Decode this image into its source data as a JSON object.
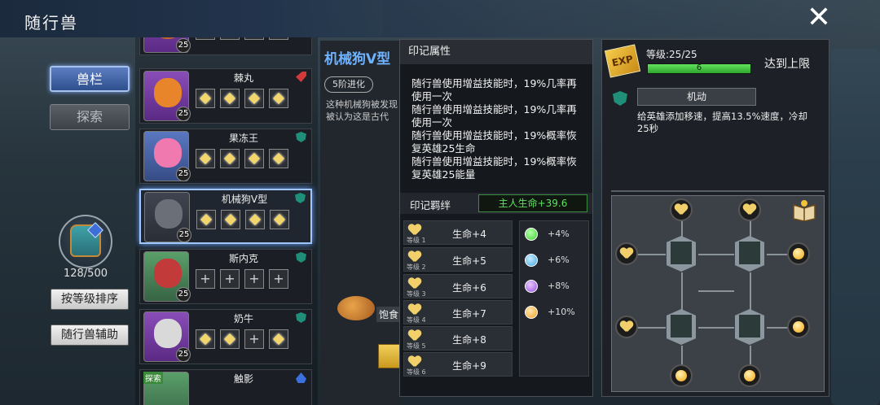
{
  "window": {
    "title": "随行兽",
    "close_label": "✕"
  },
  "left_nav": {
    "tabs": [
      {
        "label": "兽栏",
        "active": true
      },
      {
        "label": "探索",
        "active": false
      }
    ],
    "capacity": "128/500",
    "sort_button": "按等级排序",
    "assist_button": "随行兽辅助"
  },
  "pet_list": [
    {
      "name": "",
      "level": "25",
      "badge": "",
      "slots": [
        "filled",
        "filled",
        "filled",
        "filled"
      ]
    },
    {
      "name": "棘丸",
      "level": "25",
      "badge": "red",
      "slots": [
        "filled",
        "filled",
        "filled",
        "filled"
      ]
    },
    {
      "name": "果冻王",
      "level": "25",
      "badge": "teal",
      "slots": [
        "filled",
        "filled",
        "filled",
        "filled"
      ]
    },
    {
      "name": "机械狗V型",
      "level": "25",
      "badge": "teal",
      "selected": true,
      "slots": [
        "filled",
        "filled",
        "filled",
        "filled"
      ]
    },
    {
      "name": "斯内克",
      "level": "25",
      "badge": "teal",
      "slots": [
        "empty",
        "empty",
        "empty",
        "empty"
      ]
    },
    {
      "name": "奶牛",
      "level": "25",
      "badge": "teal",
      "slots": [
        "filled",
        "filled",
        "empty",
        "filled"
      ]
    },
    {
      "name": "触影",
      "level": "",
      "badge": "blue",
      "tag": "探索",
      "slots": []
    }
  ],
  "detail": {
    "pet_name": "机械狗V型",
    "evolution": "5阶进化",
    "description": "这种机械狗被发现被认为这是古代",
    "food_label": "饱食"
  },
  "imprint": {
    "header": "印记属性",
    "lines": [
      "随行兽使用增益技能时，19%几率再使用一次",
      "随行兽使用增益技能时，19%几率再使用一次",
      "随行兽使用增益技能时，19%概率恢复英雄25生命",
      "随行兽使用增益技能时，19%概率恢复英雄25能量"
    ],
    "bond_title": "印记羁绊",
    "bond_value": "主人生命+39.6",
    "life_rows": [
      {
        "level": "等级 1",
        "value": "生命+4"
      },
      {
        "level": "等级 2",
        "value": "生命+5"
      },
      {
        "level": "等级 3",
        "value": "生命+6"
      },
      {
        "level": "等级 4",
        "value": "生命+7"
      },
      {
        "level": "等级 5",
        "value": "生命+8"
      },
      {
        "level": "等级 6",
        "value": "生命+9"
      }
    ],
    "gem_bonuses": [
      {
        "color": "#3fcf3a",
        "value": "+4%"
      },
      {
        "color": "#3fa7e0",
        "value": "+6%"
      },
      {
        "color": "#9a4fe0",
        "value": "+8%"
      },
      {
        "color": "#f2a125",
        "value": "+10%"
      }
    ]
  },
  "stats": {
    "exp_icon": "EXP",
    "level_label": "等级:25/25",
    "level_bar_value": "6",
    "level_progress": 1.0,
    "max_label": "达到上限",
    "skill_name": "机动",
    "skill_desc": "给英雄添加移速，提高13.5%速度，冷却25秒"
  },
  "colors": {
    "accent_blue": "#6fb3ff",
    "bond_green": "#5fe25f",
    "exp_green": "#2ea52c"
  }
}
